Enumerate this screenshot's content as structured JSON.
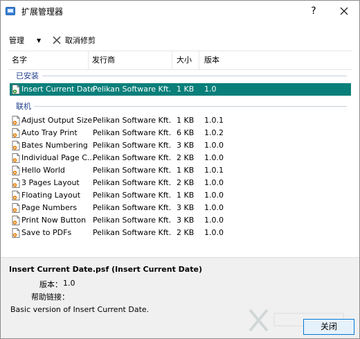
{
  "window": {
    "title": "扩展管理器",
    "help_label": "?"
  },
  "toolbar": {
    "manage_label": "管理",
    "cancel_label": "取消修剪"
  },
  "columns": {
    "name": "名字",
    "publisher": "发行商",
    "size": "大小",
    "version": "版本"
  },
  "groups": {
    "installed": "已安装",
    "online": "联机"
  },
  "installed": [
    {
      "name": "Insert Current Date",
      "publisher": "Pelikan Software Kft.",
      "size": "1 KB",
      "version": "1.0"
    }
  ],
  "online": [
    {
      "name": "Adjust Output Size",
      "publisher": "Pelikan Software Kft.",
      "size": "1 KB",
      "version": "1.0.1"
    },
    {
      "name": "Auto Tray Print",
      "publisher": "Pelikan Software Kft.",
      "size": "6 KB",
      "version": "1.0.2"
    },
    {
      "name": "Bates Numbering",
      "publisher": "Pelikan Software Kft.",
      "size": "3 KB",
      "version": "1.0.0"
    },
    {
      "name": "Individual Page C...",
      "publisher": "Pelikan Software Kft.",
      "size": "2 KB",
      "version": "1.0.0"
    },
    {
      "name": "Hello World",
      "publisher": "Pelikan Software Kft.",
      "size": "1 KB",
      "version": "1.0.1"
    },
    {
      "name": "3 Pages Layout",
      "publisher": "Pelikan Software Kft.",
      "size": "2 KB",
      "version": "1.0.0"
    },
    {
      "name": "Floating Layout",
      "publisher": "Pelikan Software Kft.",
      "size": "1 KB",
      "version": "1.0.0"
    },
    {
      "name": "Page Numbers",
      "publisher": "Pelikan Software Kft.",
      "size": "3 KB",
      "version": "1.0.0"
    },
    {
      "name": "Print Now Button",
      "publisher": "Pelikan Software Kft.",
      "size": "3 KB",
      "version": "1.0.0"
    },
    {
      "name": "Save to PDFs",
      "publisher": "Pelikan Software Kft.",
      "size": "2 KB",
      "version": "1.0.0"
    }
  ],
  "details": {
    "title": "Insert Current Date.psf (Insert Current Date)",
    "version_label": "版本：",
    "version_value": "1.0",
    "help_label": "帮助链接：",
    "description": "Basic version of Insert Current Date."
  },
  "footer": {
    "close_label": "关闭"
  },
  "colors": {
    "selection": "#0a7f7a",
    "group_text": "#1e3e8c",
    "button_border": "#0078d7"
  }
}
